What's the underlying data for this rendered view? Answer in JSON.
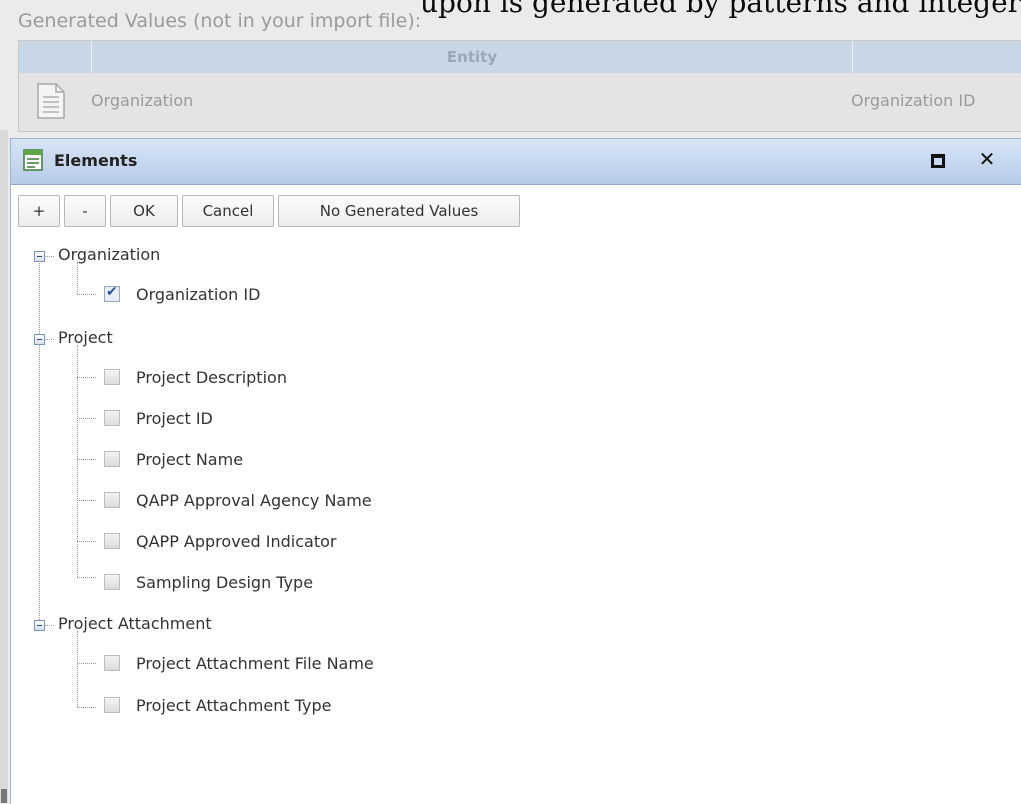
{
  "background": {
    "top_text": "upon is generated by patterns and integers",
    "heading": "Generated Values (not in your import file):",
    "table": {
      "columns": [
        "",
        "Entity",
        ""
      ],
      "row": {
        "entity": "Organization",
        "id_column": "Organization ID"
      }
    }
  },
  "dialog": {
    "title": "Elements",
    "toolbar": {
      "add": "+",
      "remove": "-",
      "ok": "OK",
      "cancel": "Cancel",
      "no_generated": "No Generated Values"
    },
    "tree": [
      {
        "label": "Organization",
        "expanded": true,
        "children": [
          {
            "label": "Organization ID",
            "checked": true
          }
        ]
      },
      {
        "label": "Project",
        "expanded": true,
        "children": [
          {
            "label": "Project Description",
            "checked": false
          },
          {
            "label": "Project ID",
            "checked": false
          },
          {
            "label": "Project Name",
            "checked": false
          },
          {
            "label": "QAPP Approval Agency Name",
            "checked": false
          },
          {
            "label": "QAPP Approved Indicator",
            "checked": false
          },
          {
            "label": "Sampling Design Type",
            "checked": false
          }
        ]
      },
      {
        "label": "Project Attachment",
        "expanded": true,
        "children": [
          {
            "label": "Project Attachment File Name",
            "checked": false
          },
          {
            "label": "Project Attachment Type",
            "checked": false
          }
        ]
      }
    ]
  }
}
